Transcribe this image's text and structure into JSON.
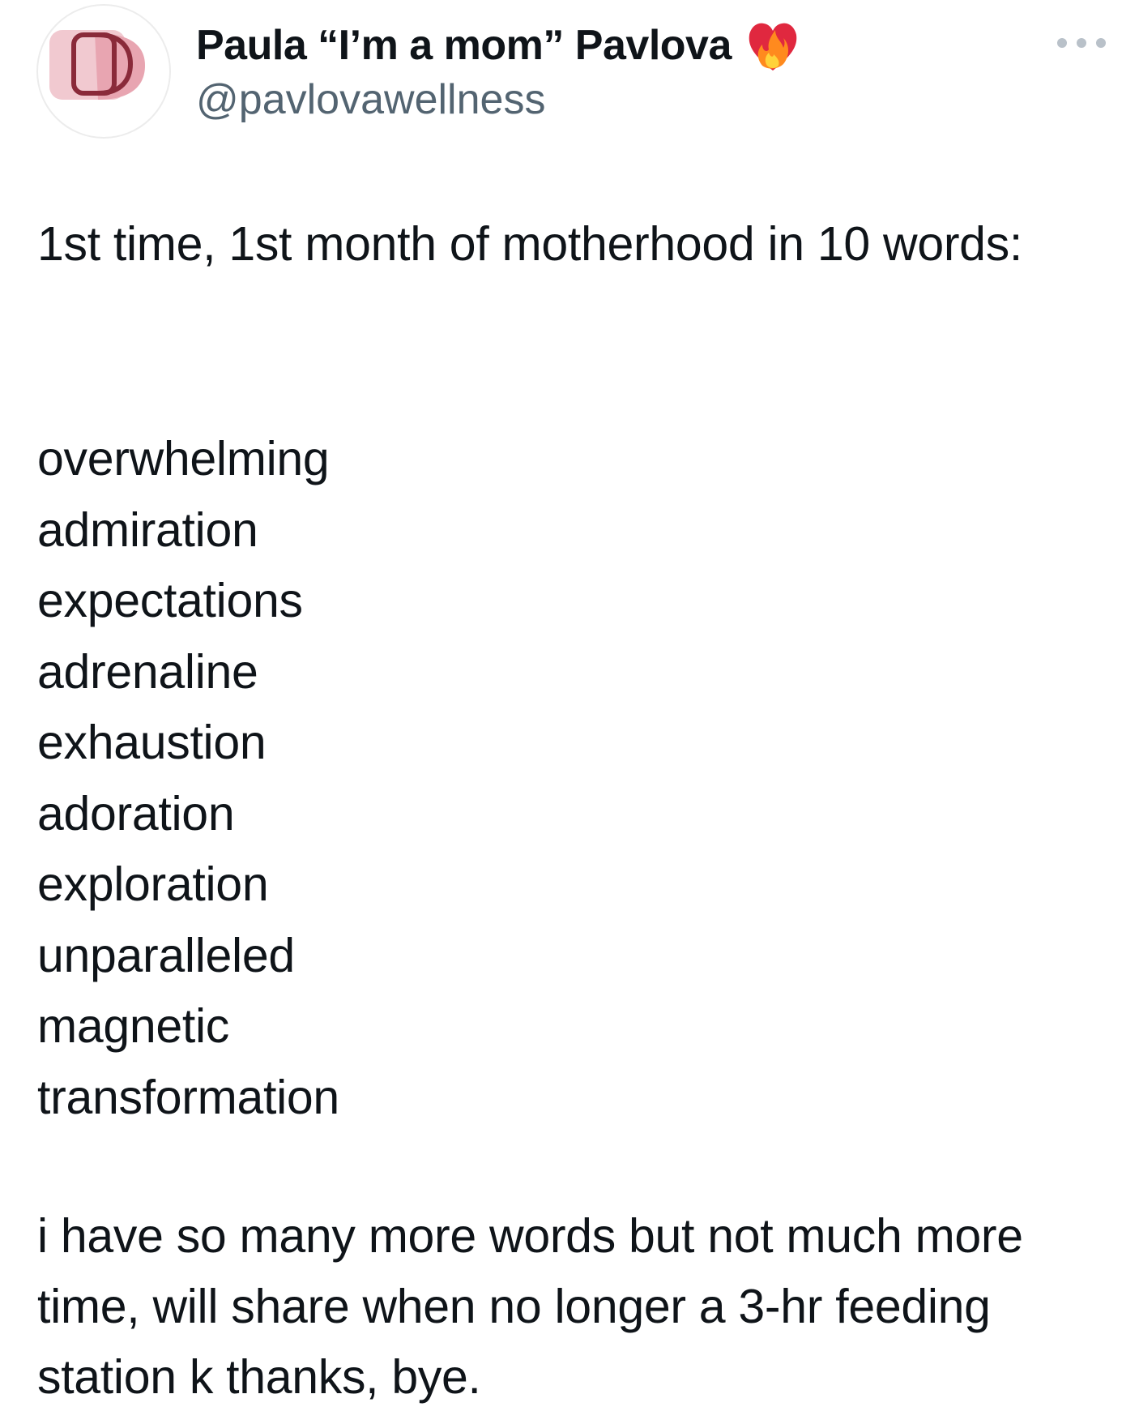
{
  "author": {
    "display_name": "Paula “I’m a mom” Pavlova",
    "handle": "@pavlovawellness",
    "avatar_icon": "pavlova-wellness-logo-icon",
    "badge_icon": "heart-on-fire-emoji-icon"
  },
  "menu": {
    "icon": "more-options-icon"
  },
  "post": {
    "intro": "1st time, 1st month of motherhood in 10 words:",
    "words": [
      "overwhelming",
      "admiration",
      "expectations",
      "adrenaline",
      "exhaustion",
      "adoration",
      "exploration",
      "unparalleled",
      "magnetic",
      "transformation"
    ],
    "closing": "i have so many more words but not much more time, will share when no longer a 3-hr feeding station k thanks, bye."
  },
  "colors": {
    "text": "#0f1419",
    "secondary": "#536471",
    "logo_dark": "#8a2a3a",
    "logo_light": "#f1c9d0",
    "logo_mid": "#e8a5b1"
  }
}
